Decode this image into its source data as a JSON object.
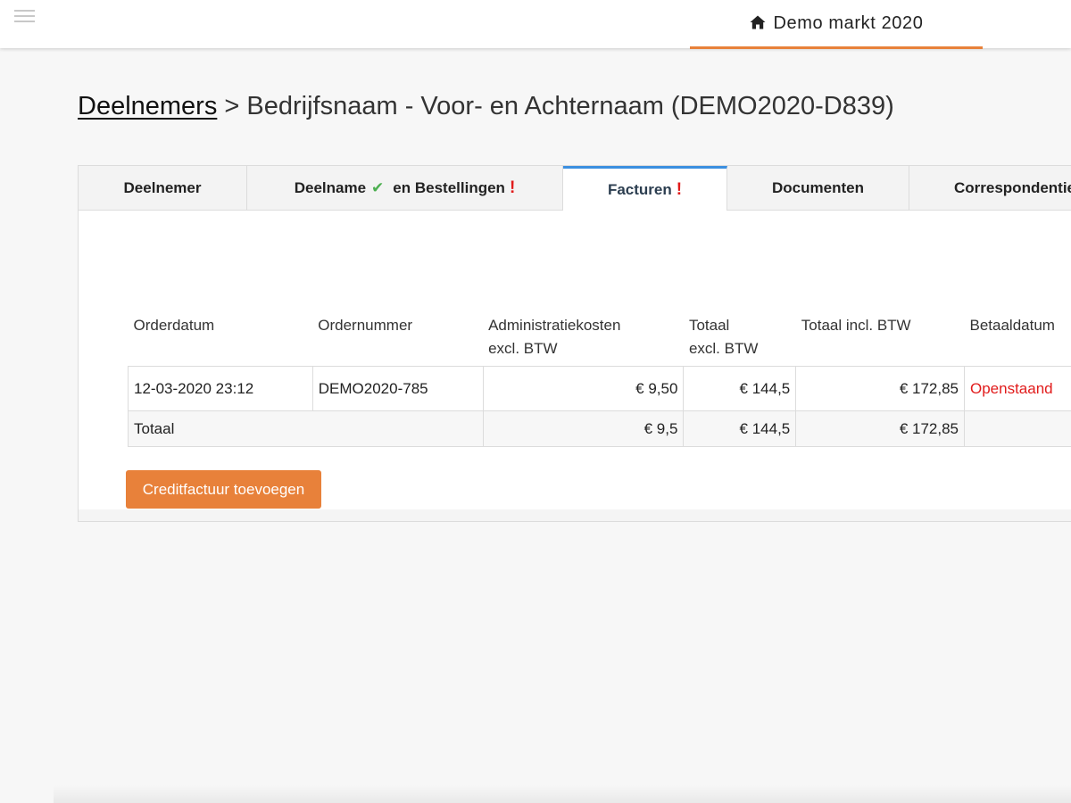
{
  "header": {
    "menu_icon": "hamburger-icon",
    "home_icon": "home-icon",
    "market_name": "Demo markt 2020"
  },
  "breadcrumb": {
    "link_label": "Deelnemers",
    "separator": ">",
    "current": "Bedrijfsnaam - Voor- en Achternaam (DEMO2020-D839)"
  },
  "tabs": [
    {
      "label": "Deelnemer",
      "active": false
    },
    {
      "label": "Deelname",
      "check_icon": "check-icon",
      "label_suffix": "en Bestellingen",
      "alert": "!",
      "active": false
    },
    {
      "label": "Facturen",
      "alert": "!",
      "active": true
    },
    {
      "label": "Documenten",
      "active": false
    },
    {
      "label": "Correspondentie",
      "active": false
    }
  ],
  "invoice_table": {
    "headers": {
      "orderdatum": "Orderdatum",
      "ordernummer": "Ordernummer",
      "admin_line1": "Administratiekosten",
      "admin_line2": "excl. BTW",
      "totaal_line1": "Totaal",
      "totaal_line2": "excl. BTW",
      "totaal_incl": "Totaal incl. BTW",
      "betaaldatum": "Betaaldatum"
    },
    "rows": [
      {
        "orderdatum": "12-03-2020 23:12",
        "ordernummer": "DEMO2020-785",
        "admin": "€ 9,50",
        "totaal_excl": "€ 144,5",
        "totaal_incl": "€ 172,85",
        "betaaldatum": "Openstaand"
      }
    ],
    "total": {
      "label": "Totaal",
      "admin": "€ 9,5",
      "totaal_excl": "€ 144,5",
      "totaal_incl": "€ 172,85"
    }
  },
  "actions": {
    "credit_invoice_label": "Creditfactuur toevoegen"
  },
  "colors": {
    "accent": "#e8813a",
    "active_tab": "#3b8fe0",
    "alert": "#e11b1b",
    "check": "#4caf50"
  }
}
